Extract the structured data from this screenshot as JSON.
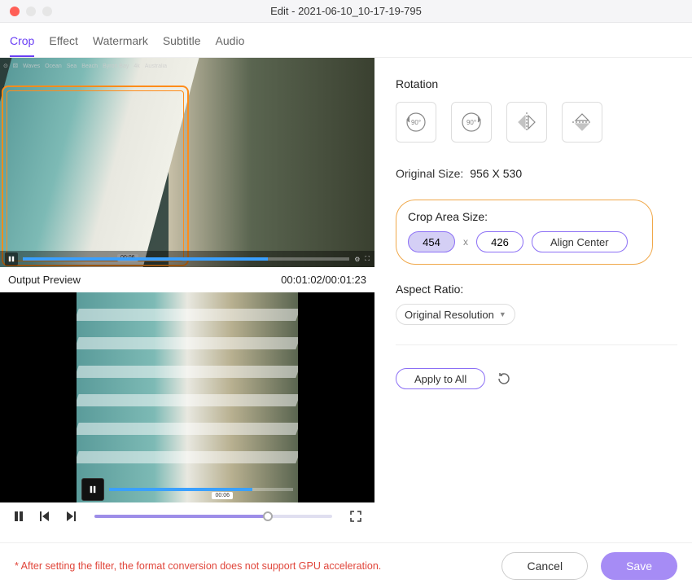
{
  "window": {
    "title": "Edit - 2021-06-10_10-17-19-795"
  },
  "tabs": [
    {
      "label": "Crop",
      "active": true
    },
    {
      "label": "Effect",
      "active": false
    },
    {
      "label": "Watermark",
      "active": false
    },
    {
      "label": "Subtitle",
      "active": false
    },
    {
      "label": "Audio",
      "active": false
    }
  ],
  "source": {
    "watermark": [
      "Waves",
      "Ocean",
      "Sea",
      "Beach",
      "Byron Bay",
      "4k",
      "Australia"
    ],
    "mini_time": "00:06"
  },
  "preview": {
    "header_label": "Output Preview",
    "time": "00:01:02/00:01:23",
    "mini_time": "00:06"
  },
  "panel": {
    "rotation_label": "Rotation",
    "rot_buttons": [
      "90°",
      "90°",
      "flip-h",
      "flip-v"
    ],
    "original_size_label": "Original Size:",
    "original_size_value": "956 X 530",
    "crop_area_label": "Crop Area Size:",
    "crop_width": "454",
    "crop_height": "426",
    "crop_separator": "x",
    "align_center_label": "Align Center",
    "aspect_label": "Aspect Ratio:",
    "aspect_value": "Original Resolution",
    "apply_all_label": "Apply to All"
  },
  "footer": {
    "warning": "* After setting the filter, the format conversion does not support GPU acceleration.",
    "cancel": "Cancel",
    "save": "Save"
  }
}
